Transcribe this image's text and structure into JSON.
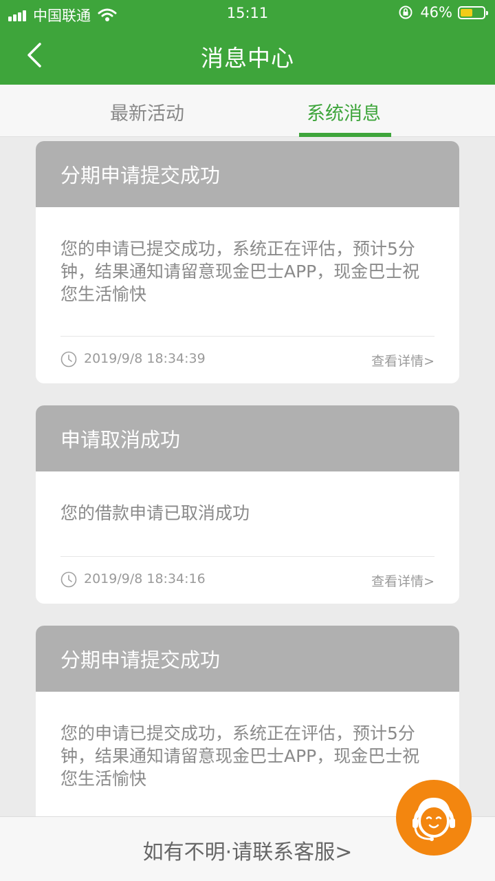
{
  "status_bar": {
    "carrier": "中国联通",
    "time": "15:11",
    "battery_percent": "46%",
    "battery_level": 0.46,
    "wifi": "wifi-icon",
    "orientation_lock": "rotation-lock-icon"
  },
  "header": {
    "title": "消息中心",
    "back_icon": "back-chevron-icon",
    "background": "#3ea53b"
  },
  "tabs": [
    {
      "label": "最新活动",
      "active": false
    },
    {
      "label": "系统消息",
      "active": true
    }
  ],
  "messages": [
    {
      "title": "分期申请提交成功",
      "body": "您的申请已提交成功，系统正在评估，预计5分钟，结果通知请留意现金巴士APP，现金巴士祝您生活愉快",
      "time": "2019/9/8 18:34:39",
      "link": "查看详情>"
    },
    {
      "title": "申请取消成功",
      "body": "您的借款申请已取消成功",
      "time": "2019/9/8 18:34:16",
      "link": "查看详情>"
    },
    {
      "title": "分期申请提交成功",
      "body": "您的申请已提交成功，系统正在评估，预计5分钟，结果通知请留意现金巴士APP，现金巴士祝您生活愉快"
    }
  ],
  "bottom": {
    "link": "如有不明·请联系客服>"
  },
  "colors": {
    "accent": "#3ea53b",
    "card_header": "#b0b0b0",
    "service_button": "#f3860f"
  }
}
